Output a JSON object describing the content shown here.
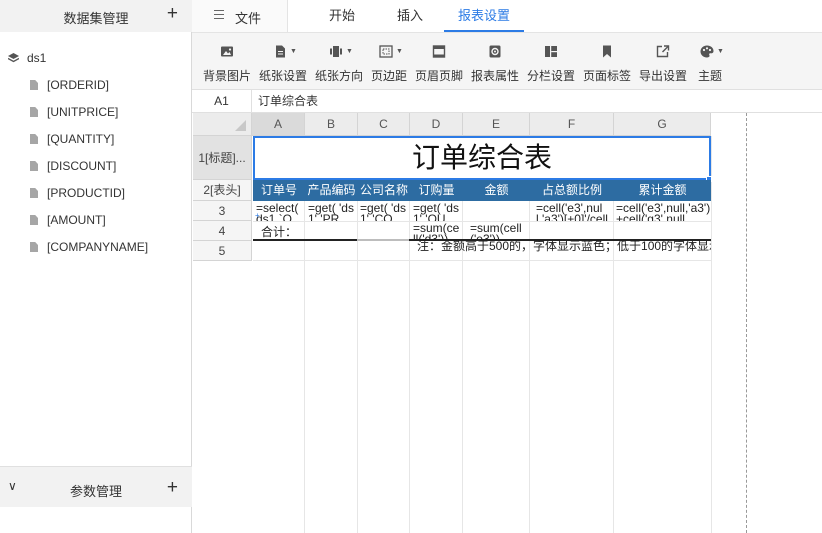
{
  "left_panel": {
    "dataset_title": "数据集管理",
    "plus": "+",
    "dataset": {
      "name": "ds1",
      "fields": [
        "[ORDERID]",
        "[UNITPRICE]",
        "[QUANTITY]",
        "[DISCOUNT]",
        "[PRODUCTID]",
        "[AMOUNT]",
        "[COMPANYNAME]"
      ]
    },
    "param_title": "参数管理",
    "chevron": "∨"
  },
  "tabs": {
    "file": "文件",
    "items": [
      "开始",
      "插入",
      "报表设置"
    ],
    "active": "报表设置"
  },
  "toolbar": {
    "items": [
      {
        "label": "背景图片",
        "icon": "image-icon",
        "dropdown": false
      },
      {
        "label": "纸张设置",
        "icon": "paper-icon",
        "dropdown": true
      },
      {
        "label": "纸张方向",
        "icon": "orientation-icon",
        "dropdown": true
      },
      {
        "label": "页边距",
        "icon": "margin-icon",
        "dropdown": true
      },
      {
        "label": "页眉页脚",
        "icon": "header-footer-icon",
        "dropdown": false
      },
      {
        "label": "报表属性",
        "icon": "gear-icon",
        "dropdown": false
      },
      {
        "label": "分栏设置",
        "icon": "columns-icon",
        "dropdown": false
      },
      {
        "label": "页面标签",
        "icon": "bookmark-icon",
        "dropdown": false
      },
      {
        "label": "导出设置",
        "icon": "export-icon",
        "dropdown": false
      },
      {
        "label": "主题",
        "icon": "palette-icon",
        "dropdown": true
      }
    ]
  },
  "formula_bar": {
    "cell_ref": "A1",
    "value": "订单综合表"
  },
  "sheet": {
    "columns": [
      "A",
      "B",
      "C",
      "D",
      "E",
      "F",
      "G"
    ],
    "rows": [
      "1[标题]...",
      "2[表头]",
      "3",
      "4",
      "5"
    ],
    "title": "订单综合表",
    "headers": [
      "订单号",
      "产品编码",
      "公司名称",
      "订购量",
      "金额",
      "占总额比例",
      "累计金额"
    ],
    "row3": [
      "=select( ds1.`O…",
      "=get( 'ds1','PRO…",
      "=get( 'ds1','COM…",
      "=get( 'ds1','QUA…",
      "",
      "=cell('e3',null,'a3')[+0]'/cell[+0]'",
      "=cell('e3',null,'a3')+cell('g3',null"
    ],
    "row4_label": "合计：",
    "row4_sum1": "=sum(ce ll('d3'))",
    "row4_sum2": "=sum(cell ('e3'))",
    "row5_note": "注：金额高于500的，字体显示蓝色；低于100的字体显示红字"
  },
  "colors": {
    "accent": "#2c7be5",
    "header_bg": "#2d6ca2"
  }
}
